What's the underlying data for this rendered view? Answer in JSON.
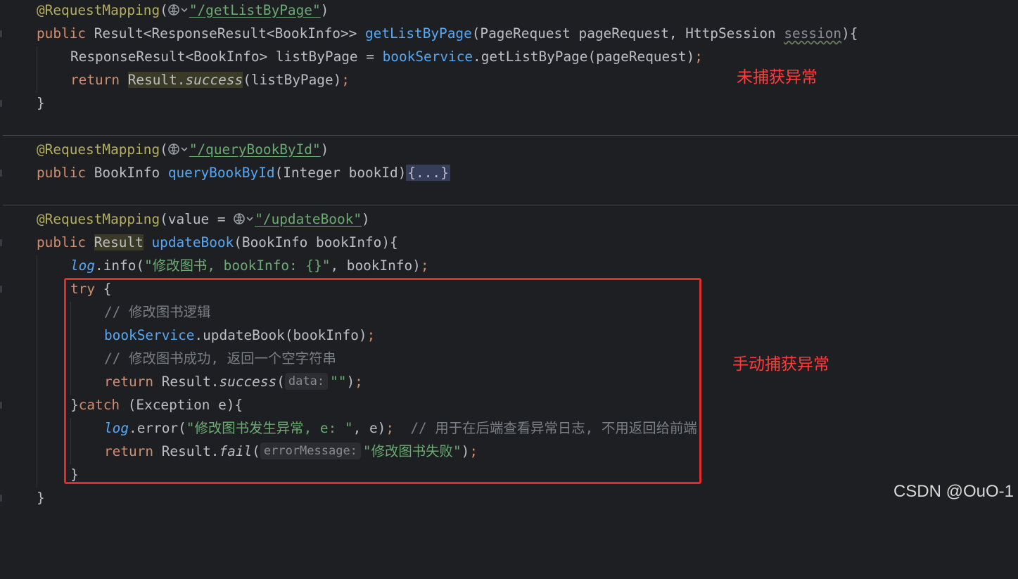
{
  "section1": {
    "annotation": "@RequestMapping",
    "path": "/getListByPage",
    "sig_public": "public ",
    "sig_type": "Result<ResponseResult<BookInfo>> ",
    "sig_name": "getListByPage",
    "sig_params": "(PageRequest pageRequest, HttpSession ",
    "sig_session": "session",
    "sig_end": "){",
    "line2_type": "ResponseResult<BookInfo> listByPage = ",
    "line2_field": "bookService",
    "line2_rest": ".getListByPage(pageRequest)",
    "line2_semi": ";",
    "line3_return": "return ",
    "line3_result": "Result",
    "line3_dot": ".",
    "line3_success": "success",
    "line3_rest": "(listByPage)",
    "line3_semi": ";",
    "close": "}"
  },
  "section2": {
    "annotation": "@RequestMapping",
    "path": "/queryBookById",
    "sig_public": "public ",
    "sig_type": "BookInfo ",
    "sig_name": "queryBookById",
    "sig_params": "(Integer bookId)",
    "folded": "{...}"
  },
  "section3": {
    "annotation": "@RequestMapping",
    "value_kw": "(value = ",
    "path": "/updateBook",
    "sig_public": "public ",
    "sig_type": "Result",
    "sig_name": "updateBook",
    "sig_params": "(BookInfo bookInfo){",
    "log_var": "log",
    "log_info": ".info(",
    "log_str": "\"修改图书, bookInfo: {}\"",
    "log_rest": ", bookInfo)",
    "semi": ";",
    "try_kw": "try",
    "try_brace": " {",
    "comment1": "// 修改图书逻辑",
    "call_field": "bookService",
    "call_rest": ".updateBook(bookInfo)",
    "comment2": "// 修改图书成功, 返回一个空字符串",
    "ret_kw": "return ",
    "ret_result": "Result.",
    "ret_success": "success",
    "ret_open": "(",
    "hint_data": "data:",
    "ret_str": "\"\"",
    "ret_close": ")",
    "catch_open": "}",
    "catch_kw": "catch",
    "catch_rest": " (Exception e){",
    "err_log": "log",
    "err_call": ".error(",
    "err_str": "\"修改图书发生异常, e: \"",
    "err_rest": ", e)",
    "err_comment": "// 用于在后端查看异常日志, 不用返回给前端",
    "fail_kw": "return ",
    "fail_result": "Result.",
    "fail_name": "fail",
    "fail_open": "(",
    "hint_error": "errorMessage:",
    "fail_str": "\"修改图书失败\"",
    "fail_close": ")",
    "inner_close": "}",
    "outer_close": "}"
  },
  "notes": {
    "uncaught": "未捕获异常",
    "manual": "手动捕获异常"
  },
  "watermark": "CSDN @OuO-1",
  "icons": [
    "globe-icon",
    "chevron-down-icon"
  ],
  "colors": {
    "background": "#1e1f22",
    "keyword": "#cf8e6d",
    "string": "#6aab73",
    "annotation": "#b3ae60",
    "comment": "#7a7e85",
    "method": "#56a8f5",
    "highlight_box": "#e22b2b"
  }
}
